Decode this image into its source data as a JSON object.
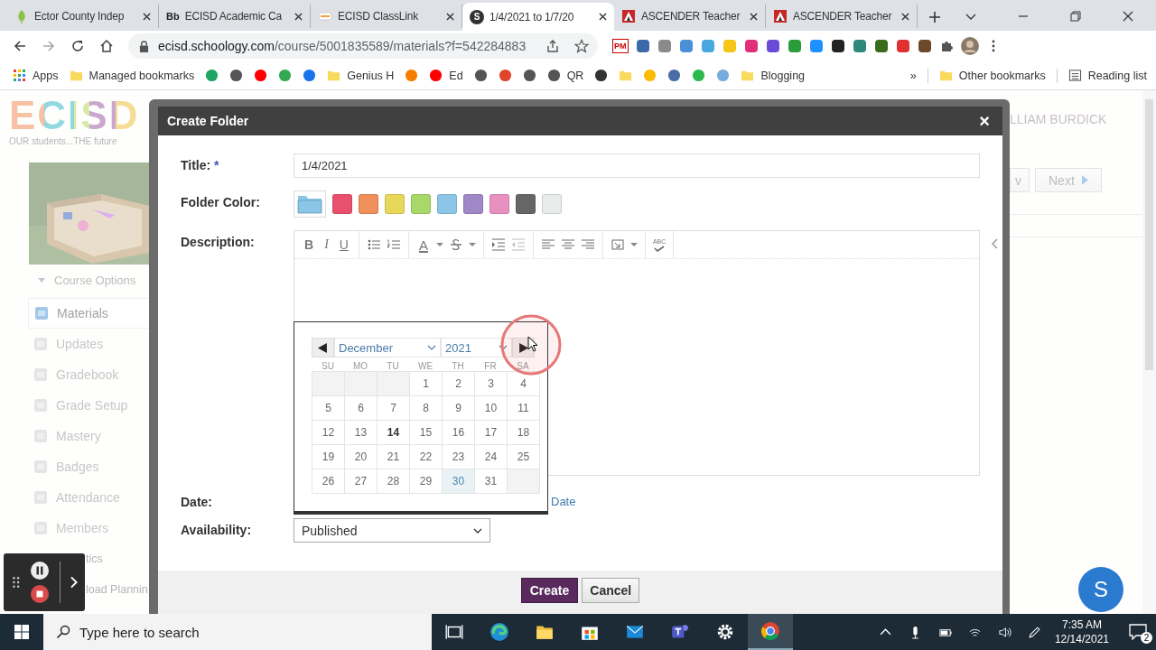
{
  "browser": {
    "tabs": [
      {
        "title": "Ector County Indep",
        "kind": "leaf",
        "selected": false
      },
      {
        "title": "ECISD Academic Ca",
        "kind": "text",
        "icon_text": "Bb",
        "selected": false
      },
      {
        "title": "ECISD ClassLink",
        "kind": "classlink",
        "selected": false
      },
      {
        "title": "1/4/2021 to 1/7/20",
        "kind": "text",
        "icon_text": "S",
        "selected": true
      },
      {
        "title": "ASCENDER Teacher",
        "kind": "ascender",
        "selected": false
      },
      {
        "title": "ASCENDER Teacher",
        "kind": "ascender",
        "selected": false
      }
    ],
    "url": {
      "host": "ecisd.schoology.com",
      "path": "/course/5001835589/materials?f=542284883"
    },
    "extension_badge": "PM",
    "bookmarks": [
      {
        "kind": "apps",
        "label": "Apps"
      },
      {
        "kind": "folder",
        "label": "Managed bookmarks"
      },
      {
        "kind": "site",
        "color": "#1fa463"
      },
      {
        "kind": "site",
        "color": "#555555"
      },
      {
        "kind": "site",
        "color": "#ff0000"
      },
      {
        "kind": "site",
        "color": "#34a853"
      },
      {
        "kind": "site",
        "color": "#1a73e8"
      },
      {
        "kind": "folder",
        "label": "Genius H"
      },
      {
        "kind": "site",
        "color": "#f57d00"
      },
      {
        "kind": "site",
        "color": "#ff0000",
        "label": "Ed"
      },
      {
        "kind": "site",
        "color": "#555555"
      },
      {
        "kind": "site",
        "color": "#e0442a"
      },
      {
        "kind": "site",
        "color": "#555555"
      },
      {
        "kind": "site",
        "color": "#555555",
        "label": "QR"
      },
      {
        "kind": "site",
        "color": "#333333"
      },
      {
        "kind": "folder"
      },
      {
        "kind": "site",
        "color": "#fbbc04"
      },
      {
        "kind": "site",
        "color": "#4a6da7"
      },
      {
        "kind": "site",
        "color": "#2db84d"
      },
      {
        "kind": "site",
        "color": "#77aadd"
      },
      {
        "kind": "folder",
        "label": "Blogging"
      }
    ],
    "overflow": "»",
    "other_bookmarks": "Other bookmarks",
    "reading_list": "Reading list"
  },
  "page": {
    "logo": {
      "text": "ECISD",
      "tagline": "OUR students...THE future"
    },
    "course_options": "Course Options",
    "nav": [
      {
        "label": "Materials",
        "selected": true,
        "covered": false
      },
      {
        "label": "Updates",
        "selected": false,
        "covered": false
      },
      {
        "label": "Gradebook",
        "selected": false,
        "covered": false
      },
      {
        "label": "Grade Setup",
        "selected": false,
        "covered": false
      },
      {
        "label": "Mastery",
        "selected": false,
        "covered": false
      },
      {
        "label": "Badges",
        "selected": false,
        "covered": false
      },
      {
        "label": "Attendance",
        "selected": false,
        "covered": false
      },
      {
        "label": "Members",
        "selected": false,
        "covered": false
      },
      {
        "label": "tics",
        "selected": false,
        "covered": true
      },
      {
        "label": "load Plannin",
        "selected": false,
        "covered": true
      }
    ],
    "user_name": "LLIAM BURDICK",
    "prev_button": "v",
    "next_button": "Next"
  },
  "dialog": {
    "title": "Create Folder",
    "close": "×",
    "title_label": "Title:",
    "required_mark": "*",
    "title_value": "1/4/2021",
    "color_label": "Folder Color:",
    "colors": [
      {
        "color": "#8cc6e6",
        "selected": true
      },
      {
        "color": "#e8506e",
        "selected": false
      },
      {
        "color": "#f0905a",
        "selected": false
      },
      {
        "color": "#e8d85a",
        "selected": false
      },
      {
        "color": "#a8d86a",
        "selected": false
      },
      {
        "color": "#8cc6e6",
        "selected": false
      },
      {
        "color": "#a088c8",
        "selected": false
      },
      {
        "color": "#e890c0",
        "selected": false
      },
      {
        "color": "#666666",
        "selected": false
      },
      {
        "color": "#e8ecea",
        "selected": false
      }
    ],
    "description_label": "Description:",
    "editor_toolbar": {
      "format": [
        "B",
        "I",
        "U"
      ],
      "font_color": "A",
      "spellcheck": "ABC"
    },
    "date_label": "Date:",
    "date_link": "Date",
    "availability_label": "Availability:",
    "availability": "Published",
    "buttons": {
      "create": "Create",
      "cancel": "Cancel"
    },
    "calendar": {
      "month": "December",
      "year": "2021",
      "weekdays": [
        "SU",
        "MO",
        "TU",
        "WE",
        "TH",
        "FR",
        "SA"
      ],
      "weeks": [
        [
          {
            "kind": "blank"
          },
          {
            "kind": "blank"
          },
          {
            "kind": "blank"
          },
          {
            "kind": "day",
            "day": "1",
            "today": false,
            "selected": false
          },
          {
            "kind": "day",
            "day": "2",
            "today": false,
            "selected": false
          },
          {
            "kind": "day",
            "day": "3",
            "today": false,
            "selected": false
          },
          {
            "kind": "day",
            "day": "4",
            "today": false,
            "selected": false
          }
        ],
        [
          {
            "kind": "day",
            "day": "5",
            "today": false,
            "selected": false
          },
          {
            "kind": "day",
            "day": "6",
            "today": false,
            "selected": false
          },
          {
            "kind": "day",
            "day": "7",
            "today": false,
            "selected": false
          },
          {
            "kind": "day",
            "day": "8",
            "today": false,
            "selected": false
          },
          {
            "kind": "day",
            "day": "9",
            "today": false,
            "selected": false
          },
          {
            "kind": "day",
            "day": "10",
            "today": false,
            "selected": false
          },
          {
            "kind": "day",
            "day": "11",
            "today": false,
            "selected": false
          }
        ],
        [
          {
            "kind": "day",
            "day": "12",
            "today": false,
            "selected": false
          },
          {
            "kind": "day",
            "day": "13",
            "today": false,
            "selected": false
          },
          {
            "kind": "day",
            "day": "14",
            "today": true,
            "selected": false
          },
          {
            "kind": "day",
            "day": "15",
            "today": false,
            "selected": false
          },
          {
            "kind": "day",
            "day": "16",
            "today": false,
            "selected": false
          },
          {
            "kind": "day",
            "day": "17",
            "today": false,
            "selected": false
          },
          {
            "kind": "day",
            "day": "18",
            "today": false,
            "selected": false
          }
        ],
        [
          {
            "kind": "day",
            "day": "19",
            "today": false,
            "selected": false
          },
          {
            "kind": "day",
            "day": "20",
            "today": false,
            "selected": false
          },
          {
            "kind": "day",
            "day": "21",
            "today": false,
            "selected": false
          },
          {
            "kind": "day",
            "day": "22",
            "today": false,
            "selected": false
          },
          {
            "kind": "day",
            "day": "23",
            "today": false,
            "selected": false
          },
          {
            "kind": "day",
            "day": "24",
            "today": false,
            "selected": false
          },
          {
            "kind": "day",
            "day": "25",
            "today": false,
            "selected": false
          }
        ],
        [
          {
            "kind": "day",
            "day": "26",
            "today": false,
            "selected": false
          },
          {
            "kind": "day",
            "day": "27",
            "today": false,
            "selected": false
          },
          {
            "kind": "day",
            "day": "28",
            "today": false,
            "selected": false
          },
          {
            "kind": "day",
            "day": "29",
            "today": false,
            "selected": false
          },
          {
            "kind": "day",
            "day": "30",
            "today": false,
            "selected": true
          },
          {
            "kind": "day",
            "day": "31",
            "today": false,
            "selected": false
          },
          {
            "kind": "blank"
          }
        ]
      ]
    }
  },
  "schoology_button": "S",
  "taskbar": {
    "search_placeholder": "Type here to search",
    "time": "7:35 AM",
    "date": "12/14/2021",
    "notifications": "2"
  }
}
